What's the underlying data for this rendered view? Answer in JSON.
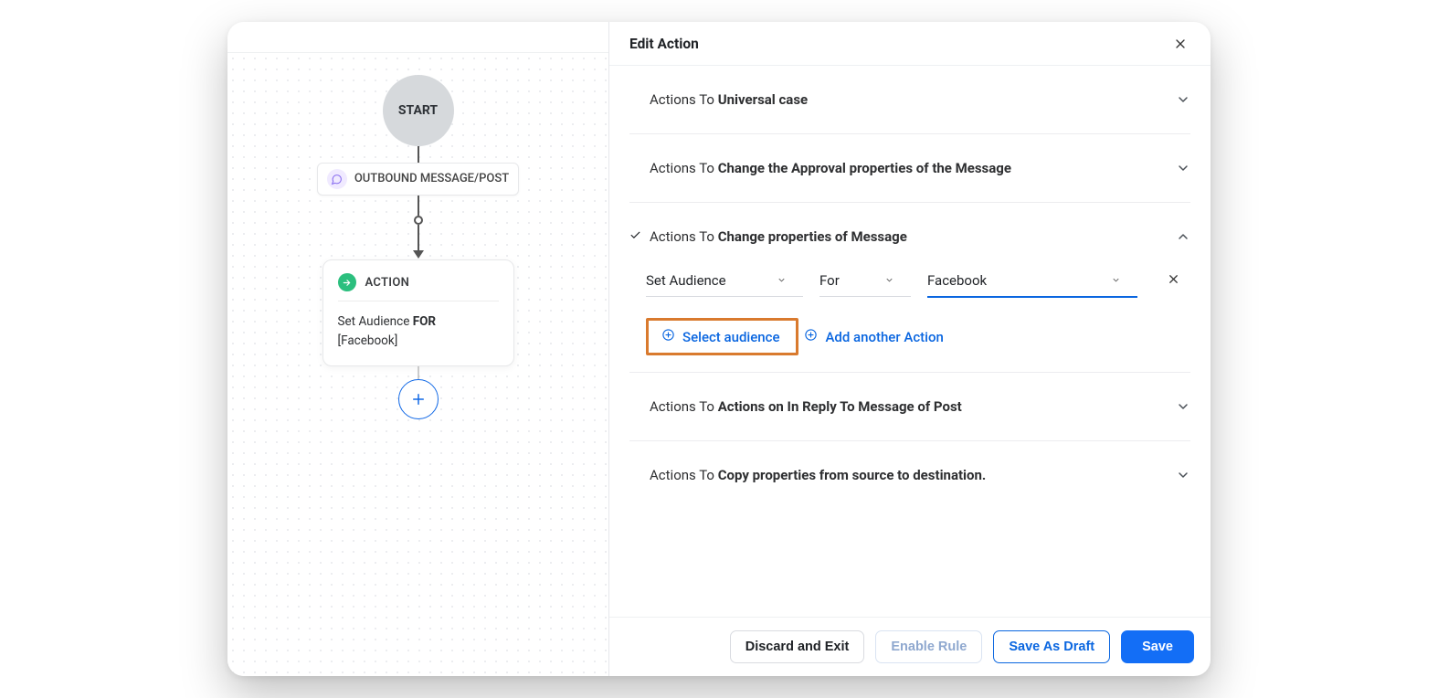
{
  "panel": {
    "title": "Edit Action"
  },
  "flow": {
    "start": "START",
    "trigger": "OUTBOUND MESSAGE/POST",
    "action_label": "ACTION",
    "action_line1": "Set Audience ",
    "action_for": "FOR",
    "action_line2": "[Facebook]"
  },
  "sections": {
    "prefix": "Actions To ",
    "s0": "Universal case",
    "s1": "Change the Approval properties of the Message",
    "s2": "Change properties of Message",
    "s3": "Actions on In Reply To Message of Post",
    "s4": "Copy properties from source to destination."
  },
  "config": {
    "field0": "Set Audience",
    "field1": "For",
    "field2": "Facebook",
    "select_audience": "Select audience",
    "add_another": "Add another Action"
  },
  "footer": {
    "discard": "Discard and Exit",
    "enable": "Enable Rule",
    "draft": "Save As Draft",
    "save": "Save"
  }
}
